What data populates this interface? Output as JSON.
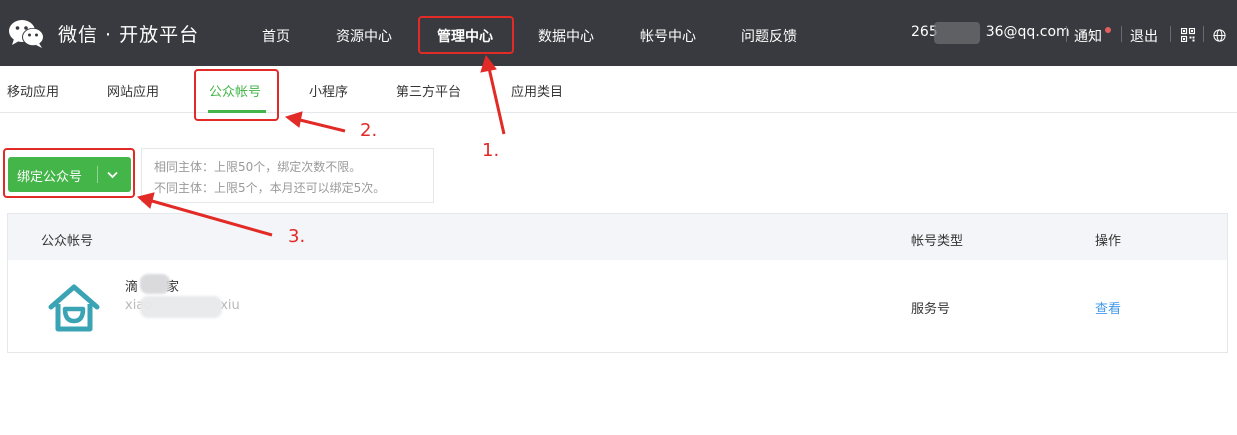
{
  "header": {
    "brand": "微信 · 开放平台",
    "nav": [
      "首页",
      "资源中心",
      "管理中心",
      "数据中心",
      "帐号中心",
      "问题反馈"
    ],
    "active_nav": "管理中心",
    "email_prefix": "265",
    "email_suffix": "36@qq.com",
    "notice": "通知",
    "logout": "退出",
    "icons": [
      "wechat-logo",
      "qrcode-icon",
      "globe-icon"
    ]
  },
  "tabs": {
    "items": [
      "移动应用",
      "网站应用",
      "公众帐号",
      "小程序",
      "第三方平台",
      "应用类目"
    ],
    "active": "公众帐号"
  },
  "bind": {
    "button_label": "绑定公众号",
    "tip_line1": "相同主体：上限50个，绑定次数不限。",
    "tip_line2": "不同主体：上限5个，本月还可以绑定5次。"
  },
  "table": {
    "headers": {
      "account": "公众帐号",
      "type": "帐号类型",
      "action": "操作"
    },
    "rows": [
      {
        "name_start": "滴",
        "name_end": "家",
        "id_start": "xiao",
        "id_end": "xiu",
        "type": "服务号",
        "action": "查看"
      }
    ]
  },
  "annotations": [
    "1.",
    "2.",
    "3."
  ],
  "colors": {
    "topbar": "#393a3f",
    "accent_green": "#44b549",
    "link_blue": "#459ae9",
    "annotation_red": "#e22a26"
  }
}
